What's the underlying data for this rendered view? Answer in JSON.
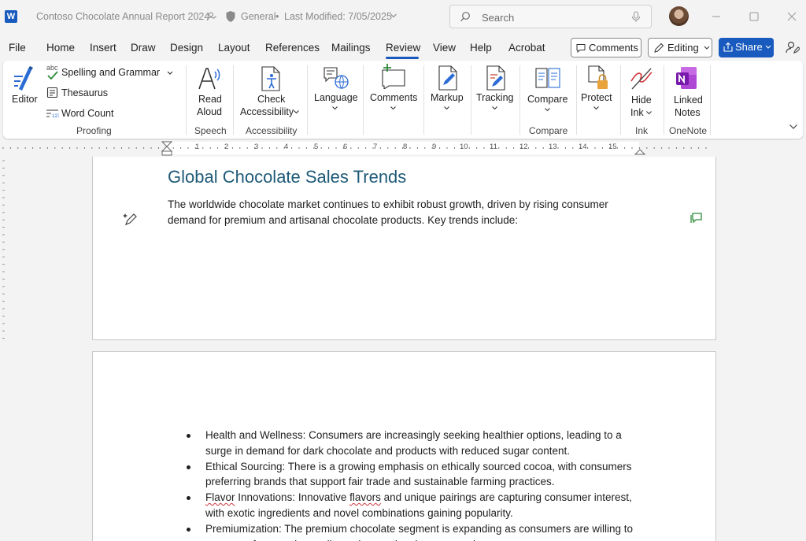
{
  "titlebar": {
    "app_letter": "W",
    "doc_title": "Contoso Chocolate Annual Report 2024",
    "sensitivity": "General",
    "separator": "•",
    "last_modified": "Last Modified: 7/05/2025",
    "search_placeholder": "Search"
  },
  "tabs": [
    "File",
    "Home",
    "Insert",
    "Draw",
    "Design",
    "Layout",
    "References",
    "Mailings",
    "Review",
    "View",
    "Help",
    "Acrobat"
  ],
  "active_tab": "Review",
  "actions": {
    "comments": "Comments",
    "editing": "Editing",
    "share": "Share"
  },
  "ribbon": {
    "editor": "Editor",
    "spelling": "Spelling and Grammar",
    "spelling_abc": "abc",
    "thesaurus": "Thesaurus",
    "word_count": "Word Count",
    "proofing": "Proofing",
    "read_aloud_1": "Read",
    "read_aloud_2": "Aloud",
    "speech": "Speech",
    "check_acc_1": "Check",
    "check_acc_2": "Accessibility",
    "accessibility": "Accessibility",
    "language": "Language",
    "comments": "Comments",
    "markup": "Markup",
    "tracking": "Tracking",
    "compare": "Compare",
    "compare_group": "Compare",
    "protect": "Protect",
    "hide_ink_1": "Hide",
    "hide_ink_2": "Ink",
    "ink": "Ink",
    "linked_notes_1": "Linked",
    "linked_notes_2": "Notes",
    "onenote": "OneNote"
  },
  "ruler": {
    "numbers": [
      "1",
      "2",
      "3",
      "4",
      "5",
      "6",
      "7",
      "8",
      "9",
      "10",
      "11",
      "12",
      "13",
      "14",
      "15"
    ]
  },
  "document": {
    "heading": "Global Chocolate Sales Trends",
    "paragraph": "The worldwide chocolate market continues to exhibit robust growth, driven by rising consumer demand for premium and artisanal chocolate products. Key trends include:",
    "bullets": [
      {
        "parts": [
          {
            "t": "Health and Wellness: Consumers are increasingly seeking healthier options, leading to a surge in demand for dark chocolate and products with reduced sugar content.",
            "err": false
          }
        ]
      },
      {
        "parts": [
          {
            "t": "Ethical Sourcing: There is a growing emphasis on ethically sourced cocoa, with consumers preferring brands that support fair trade and sustainable farming practices.",
            "err": false
          }
        ]
      },
      {
        "parts": [
          {
            "t": "Flavor",
            "err": true
          },
          {
            "t": " Innovations: Innovative ",
            "err": false
          },
          {
            "t": "flavors",
            "err": true
          },
          {
            "t": " and unique pairings are capturing consumer interest, with exotic ingredients and novel combinations gaining popularity.",
            "err": false
          }
        ]
      },
      {
        "parts": [
          {
            "t": "Premiumization: The premium chocolate segment is expanding as consumers are willing to pay more for superior quality and exceptional taste experiences.",
            "err": false
          }
        ]
      }
    ]
  },
  "colors": {
    "accent": "#185abd",
    "heading": "#1e5a78",
    "spell_error": "#d13438"
  }
}
